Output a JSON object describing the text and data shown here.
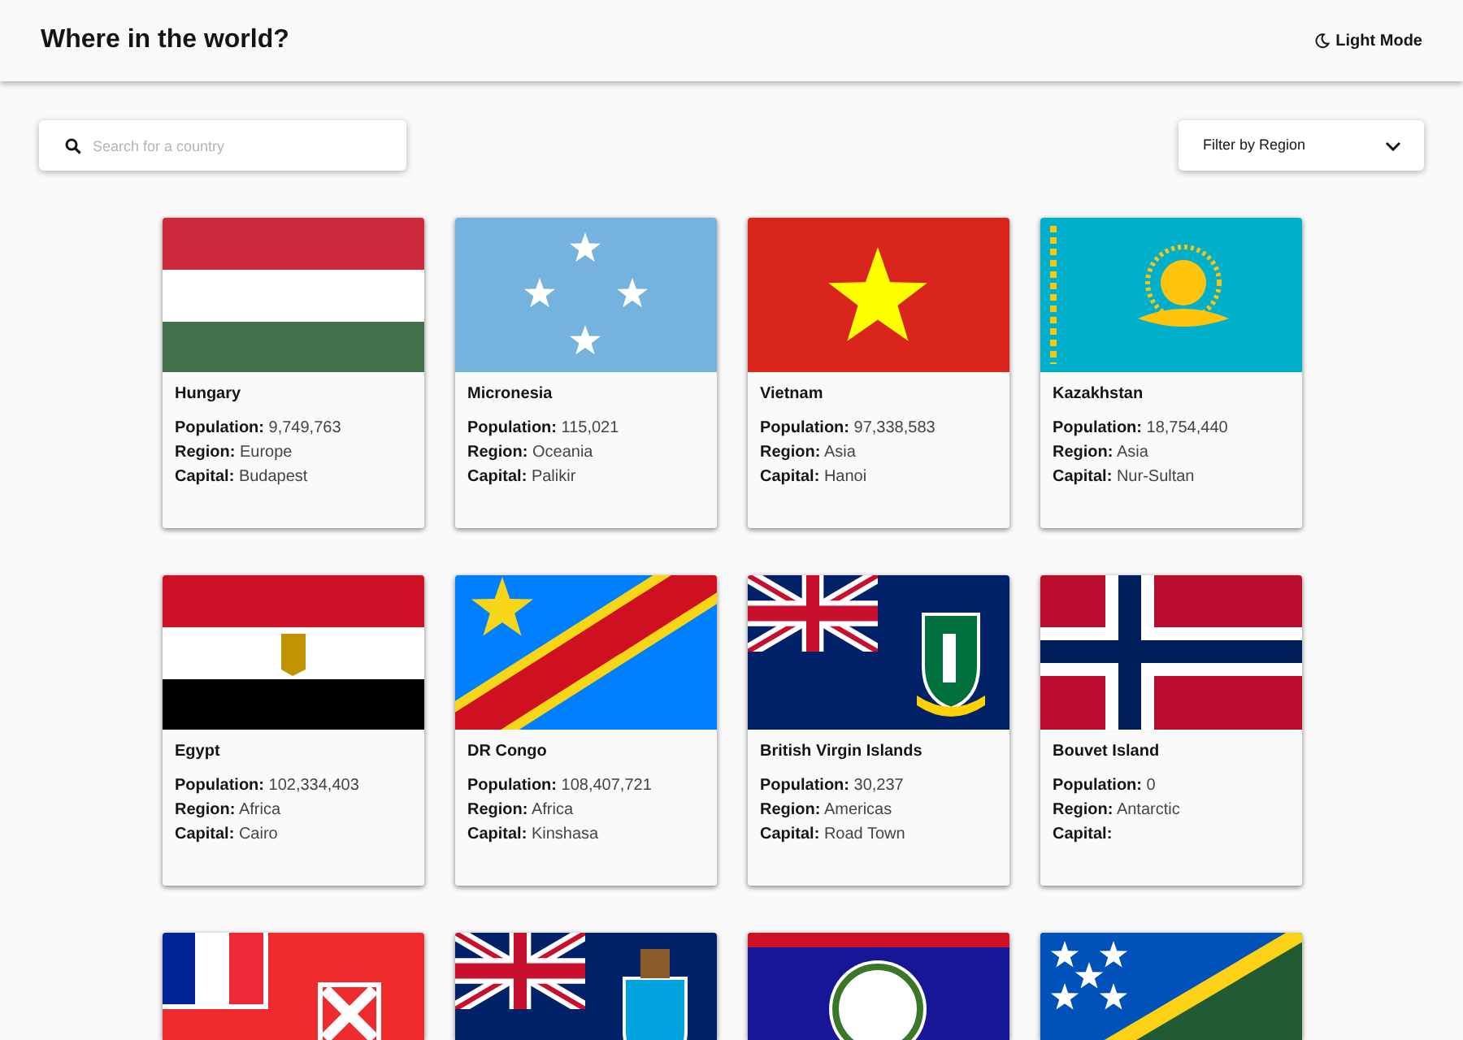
{
  "header": {
    "title": "Where in the world?",
    "mode_toggle": "Light Mode"
  },
  "search": {
    "placeholder": "Search for a country"
  },
  "filter": {
    "label": "Filter by Region"
  },
  "countries": [
    {
      "kind": "hungary",
      "name": "Hungary",
      "fields": [
        {
          "label": "Population:",
          "value": "9,749,763"
        },
        {
          "label": "Region:",
          "value": "Europe"
        },
        {
          "label": "Capital:",
          "value": "Budapest"
        }
      ]
    },
    {
      "kind": "micronesia",
      "name": "Micronesia",
      "fields": [
        {
          "label": "Population:",
          "value": "115,021"
        },
        {
          "label": "Region:",
          "value": "Oceania"
        },
        {
          "label": "Capital:",
          "value": "Palikir"
        }
      ]
    },
    {
      "kind": "vietnam",
      "name": "Vietnam",
      "fields": [
        {
          "label": "Population:",
          "value": "97,338,583"
        },
        {
          "label": "Region:",
          "value": "Asia"
        },
        {
          "label": "Capital:",
          "value": "Hanoi"
        }
      ]
    },
    {
      "kind": "kazakhstan",
      "name": "Kazakhstan",
      "fields": [
        {
          "label": "Population:",
          "value": "18,754,440"
        },
        {
          "label": "Region:",
          "value": "Asia"
        },
        {
          "label": "Capital:",
          "value": "Nur-Sultan"
        }
      ]
    },
    {
      "kind": "egypt",
      "name": "Egypt",
      "fields": [
        {
          "label": "Population:",
          "value": "102,334,403"
        },
        {
          "label": "Region:",
          "value": "Africa"
        },
        {
          "label": "Capital:",
          "value": "Cairo"
        }
      ]
    },
    {
      "kind": "drcongo",
      "name": "DR Congo",
      "fields": [
        {
          "label": "Population:",
          "value": "108,407,721"
        },
        {
          "label": "Region:",
          "value": "Africa"
        },
        {
          "label": "Capital:",
          "value": "Kinshasa"
        }
      ]
    },
    {
      "kind": "bvi",
      "name": "British Virgin Islands",
      "fields": [
        {
          "label": "Population:",
          "value": "30,237"
        },
        {
          "label": "Region:",
          "value": "Americas"
        },
        {
          "label": "Capital:",
          "value": "Road Town"
        }
      ]
    },
    {
      "kind": "bouvet",
      "name": "Bouvet Island",
      "fields": [
        {
          "label": "Population:",
          "value": "0"
        },
        {
          "label": "Region:",
          "value": "Antarctic"
        },
        {
          "label": "Capital:"
        }
      ]
    },
    {
      "kind": "wallis"
    },
    {
      "kind": "sgssi"
    },
    {
      "kind": "belize"
    },
    {
      "kind": "solomon"
    }
  ]
}
